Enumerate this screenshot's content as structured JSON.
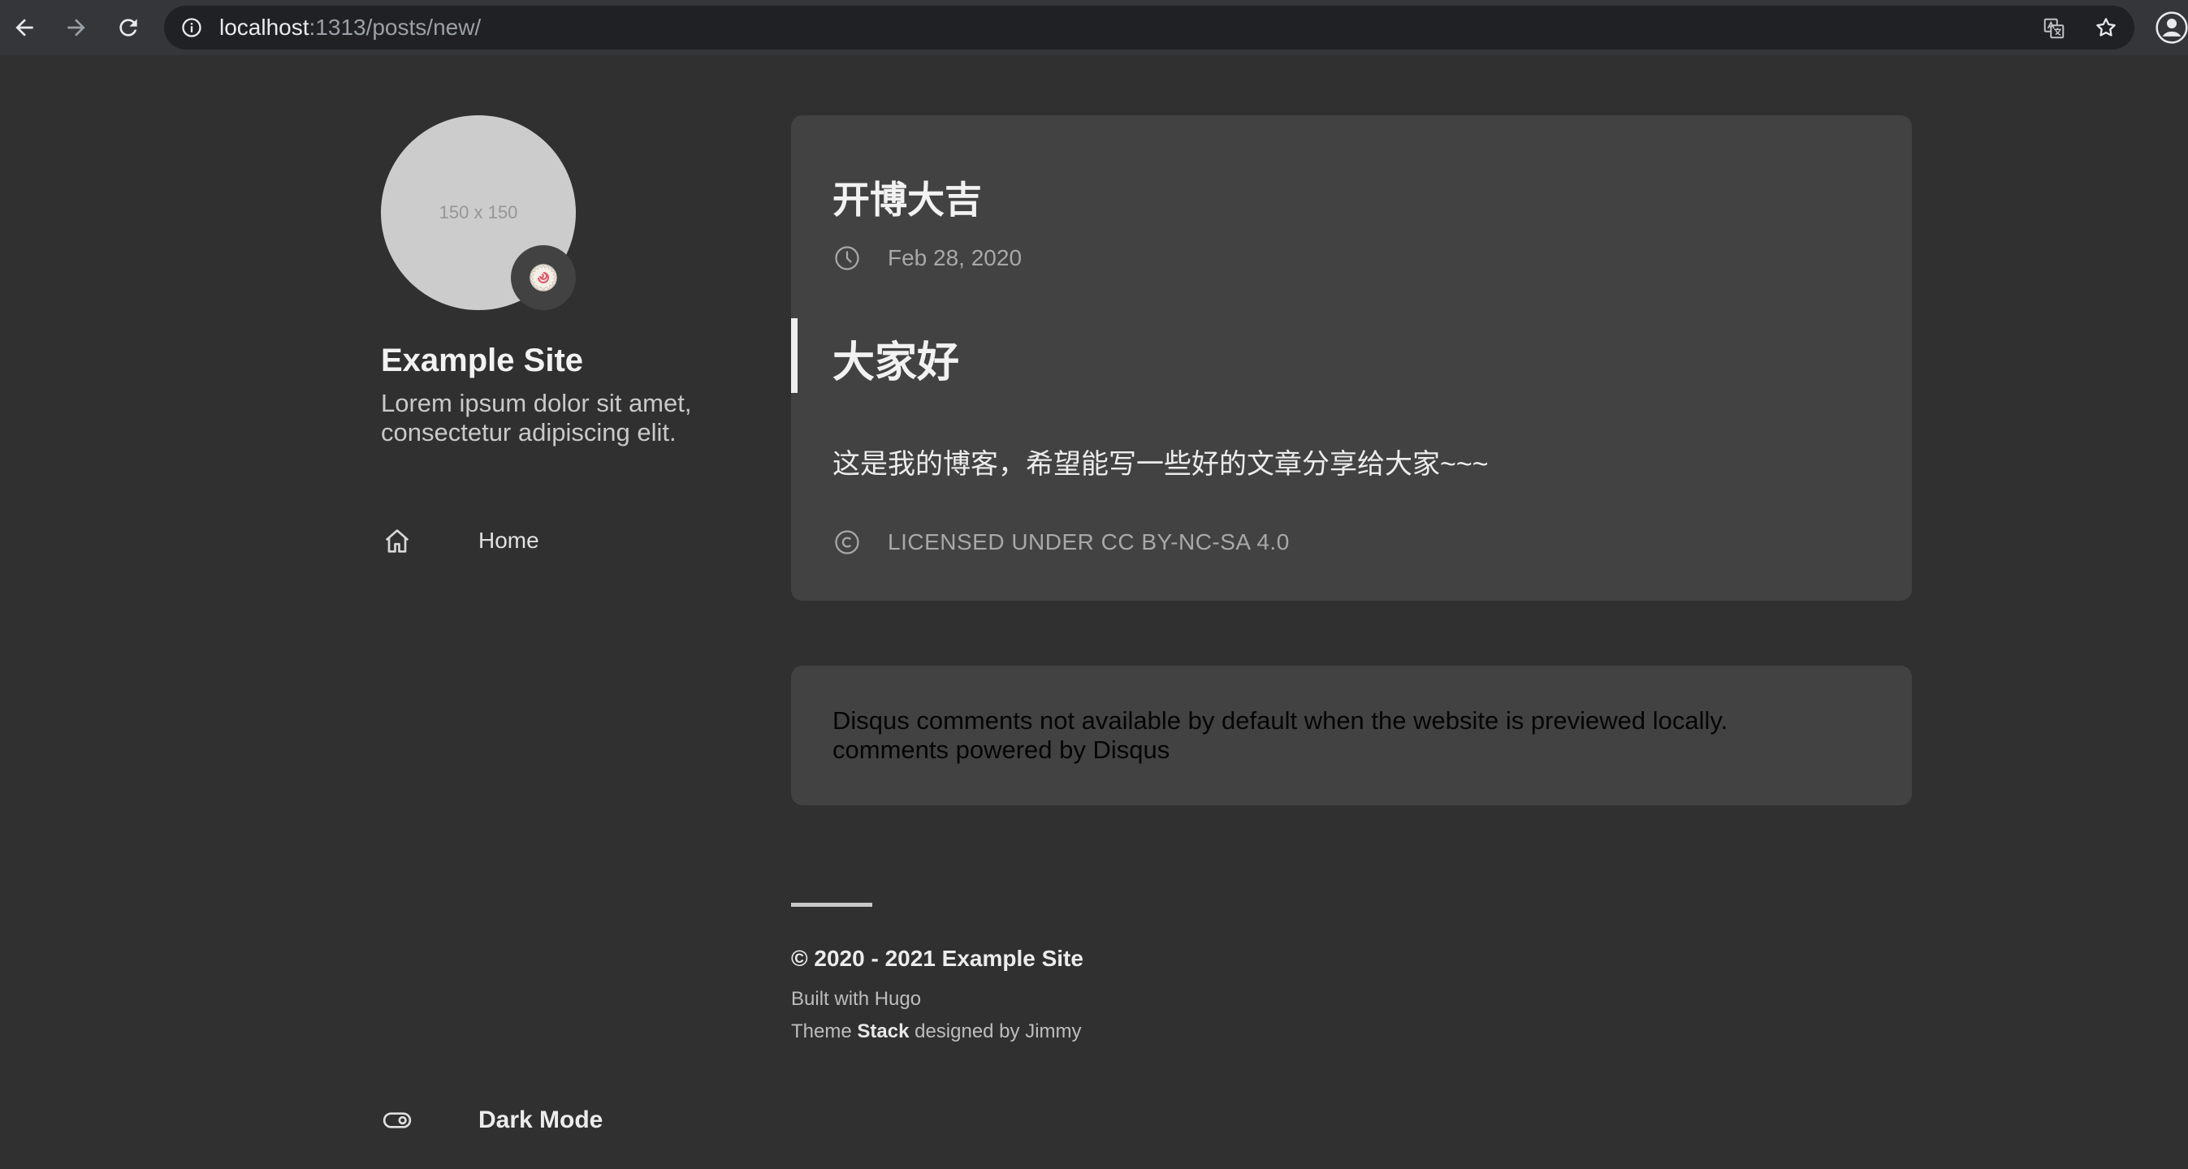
{
  "browser": {
    "url_host": "localhost",
    "url_path": ":1313/posts/new/"
  },
  "sidebar": {
    "avatar_placeholder": "150 x 150",
    "emoji": "🍥",
    "site_name": "Example Site",
    "site_description": "Lorem ipsum dolor sit amet, consectetur adipiscing elit.",
    "menu": [
      {
        "label": "Home",
        "icon": "home-icon"
      }
    ],
    "dark_mode_label": "Dark Mode"
  },
  "article": {
    "title": "开博大吉",
    "date": "Feb 28, 2020",
    "heading": "大家好",
    "paragraph": "这是我的博客，希望能写一些好的文章分享给大家~~~",
    "license": "LICENSED UNDER CC BY-NC-SA 4.0"
  },
  "comments": {
    "line1": "Disqus comments not available by default when the website is previewed locally.",
    "line2": "comments powered by Disqus"
  },
  "footer": {
    "copyright": "© 2020 - 2021 Example Site",
    "built_with": "Built with Hugo",
    "theme_prefix": "Theme ",
    "theme_name": "Stack",
    "theme_suffix": " designed by Jimmy"
  },
  "colors": {
    "page_background": "#303030",
    "card_background": "#424242",
    "browser_bar": "#35363a"
  }
}
